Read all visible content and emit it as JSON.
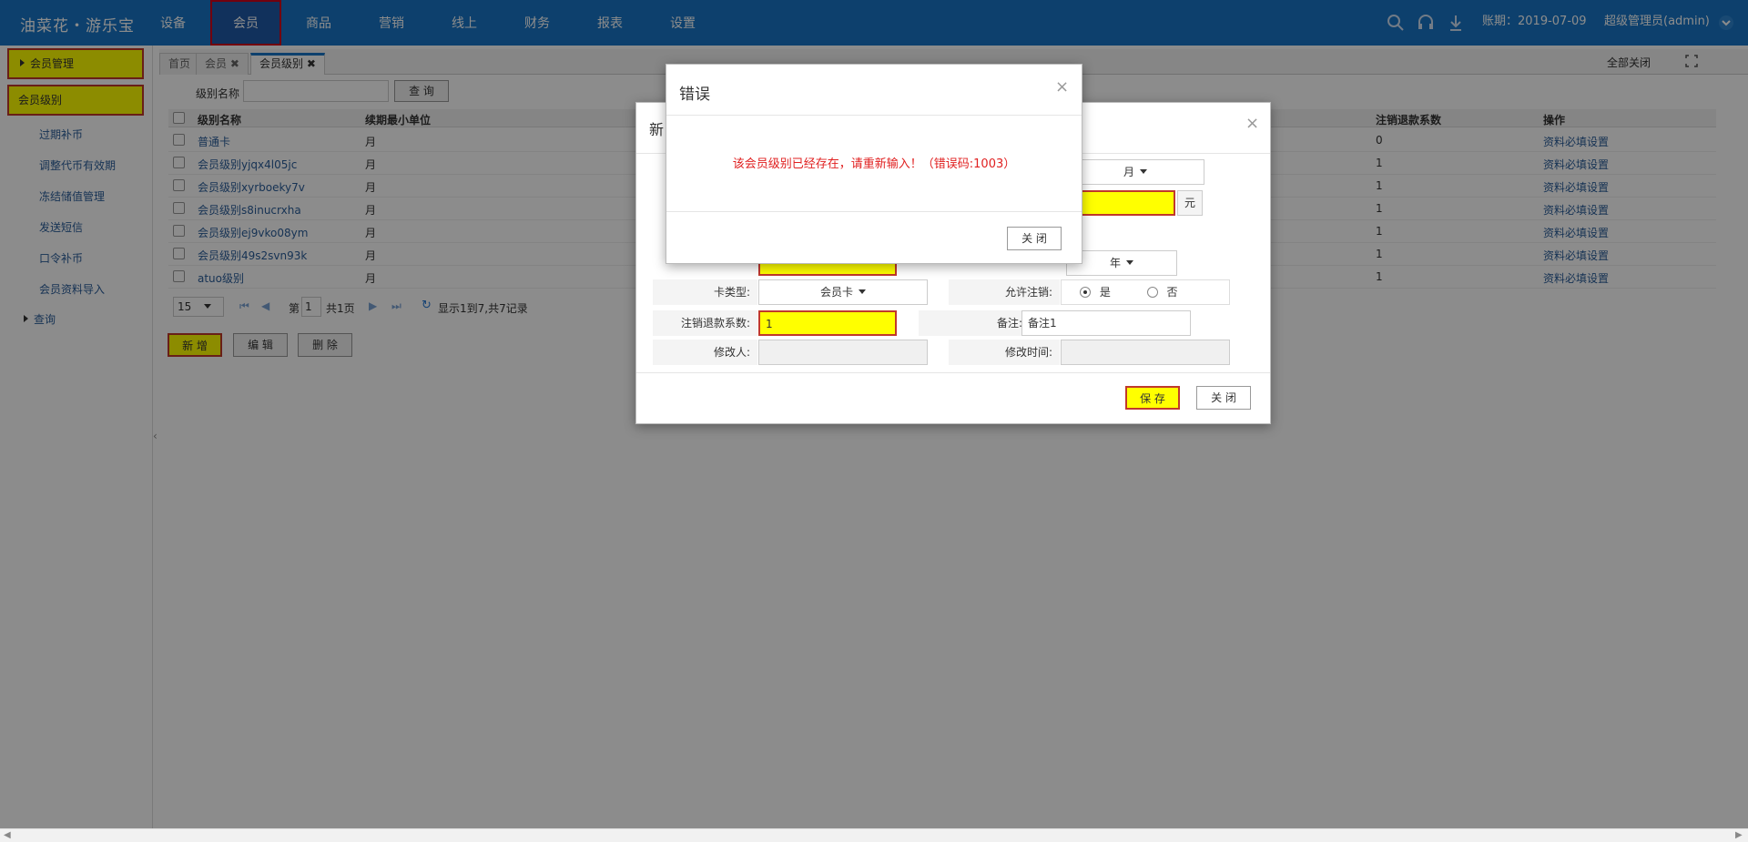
{
  "app": {
    "logo": "油菜花・游乐宝",
    "nav": [
      "设备",
      "会员",
      "商品",
      "营销",
      "线上",
      "财务",
      "报表",
      "设置"
    ],
    "nav_active": "会员",
    "account_period": "账期：2019-07-09",
    "user": "超级管理员(admin)"
  },
  "sidebar": {
    "group1": "会员管理",
    "group2": "会员级别",
    "items": [
      "过期补币",
      "调整代币有效期",
      "冻结储值管理",
      "发送短信",
      "口令补币",
      "会员资料导入"
    ],
    "group3": "查询"
  },
  "tabs": {
    "items": [
      "首页",
      "会员",
      "会员级别"
    ],
    "close_all": "全部关闭"
  },
  "search": {
    "label": "级别名称",
    "value": "",
    "button": "查 询"
  },
  "table": {
    "headers": [
      "级别名称",
      "续期最小单位",
      "注销退款系数",
      "操作"
    ],
    "rows": [
      {
        "name": "普通卡",
        "unit": "月",
        "coef": "0",
        "op": "资料必填设置"
      },
      {
        "name": "会员级别yjqx4l05jc",
        "unit": "月",
        "coef": "1",
        "op": "资料必填设置"
      },
      {
        "name": "会员级别xyrboeky7v",
        "unit": "月",
        "coef": "1",
        "op": "资料必填设置"
      },
      {
        "name": "会员级别s8inucrxha",
        "unit": "月",
        "coef": "1",
        "op": "资料必填设置"
      },
      {
        "name": "会员级别ej9vko08ym",
        "unit": "月",
        "coef": "1",
        "op": "资料必填设置"
      },
      {
        "name": "会员级别49s2svn93k",
        "unit": "月",
        "coef": "1",
        "op": "资料必填设置"
      },
      {
        "name": "atuo级别",
        "unit": "月",
        "coef": "1",
        "op": "资料必填设置"
      }
    ]
  },
  "pager": {
    "page_size": "15",
    "page_prefix": "第",
    "page": "1",
    "page_total": "共1页",
    "summary": "显示1到7,共7记录"
  },
  "actions": {
    "add": "新 增",
    "edit": "编 辑",
    "delete": "删 除"
  },
  "form_modal": {
    "title": "新",
    "unit_select": "月",
    "yuan": "元",
    "year_select": "年",
    "card_type_label": "卡类型:",
    "card_type": "会员卡",
    "allow_cancel_label": "允许注销:",
    "yes": "是",
    "no": "否",
    "refund_label": "注销退款系数:",
    "refund_value": "1",
    "remark_label": "备注:",
    "remark_value": "备注1",
    "modifier_label": "修改人:",
    "modified_time_label": "修改时间:",
    "save": "保 存",
    "close": "关 闭"
  },
  "error_modal": {
    "title": "错误",
    "message": "该会员级别已经存在，请重新输入！（错误码:1003）",
    "close": "关 闭"
  },
  "colors": {
    "topbar": "#1976c6",
    "highlight": "#ffff00",
    "highlight_border": "#c0392b",
    "error_text": "#e02020"
  }
}
